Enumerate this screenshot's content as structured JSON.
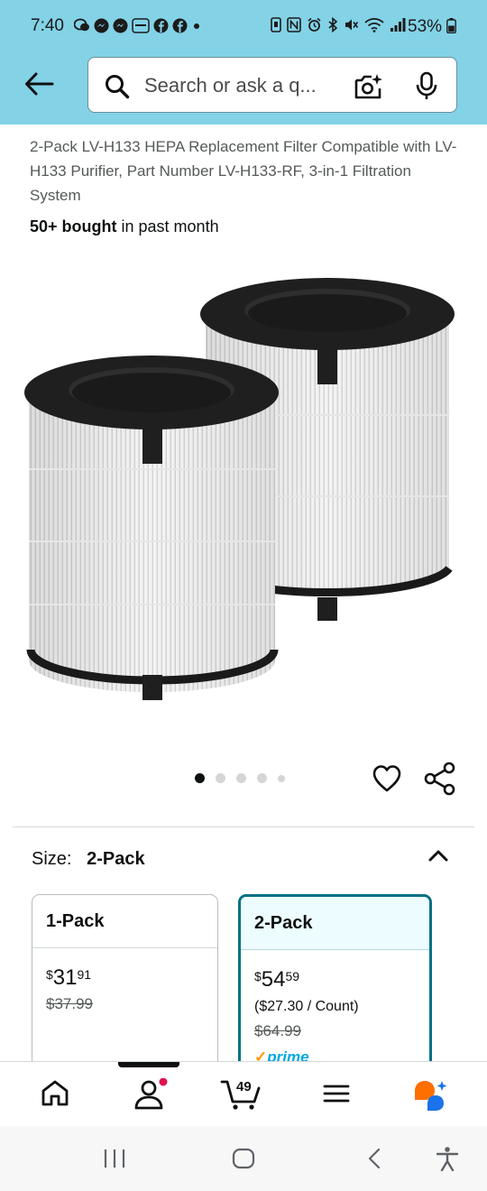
{
  "status_bar": {
    "time": "7:40",
    "battery": "53%",
    "notification_icons": [
      "wechat-icon",
      "messenger-icon",
      "messenger-icon",
      "temu-icon",
      "facebook-icon",
      "facebook-icon",
      "dot-icon"
    ],
    "system_icons": [
      "nfc-icon",
      "n-icon",
      "alarm-icon",
      "bluetooth-icon",
      "mute-icon",
      "wifi-icon",
      "signal-icon"
    ]
  },
  "search": {
    "placeholder": "Search or ask a q..."
  },
  "product": {
    "title": "2-Pack LV-H133 HEPA Replacement Filter Compatible with LV-H133 Purifier, Part Number LV-H133-RF, 3-in-1 Filtration System",
    "bought_bold": "50+ bought",
    "bought_rest": " in past month",
    "carousel_total": 5,
    "carousel_active": 0
  },
  "size": {
    "label": "Size:",
    "selected": "2-Pack",
    "options": [
      {
        "name": "1-Pack",
        "dollar": "$",
        "whole": "31",
        "cents": "91",
        "list_price": "$37.99"
      },
      {
        "name": "2-Pack",
        "dollar": "$",
        "whole": "54",
        "cents": "59",
        "unit_price": "($27.30 / Count)",
        "list_price": "$64.99",
        "prime": "prime",
        "prime_check": "✓"
      }
    ]
  },
  "bottom_nav": {
    "items": [
      "home-icon",
      "account-icon",
      "cart-icon",
      "menu-icon",
      "rufus-ai-icon"
    ],
    "cart_count": "49",
    "active": "account-icon"
  },
  "colors": {
    "header_bg": "#83d2e6",
    "selected_border": "#007185",
    "prime_blue": "#00a8e1",
    "notification_dot": "#e0134f"
  }
}
